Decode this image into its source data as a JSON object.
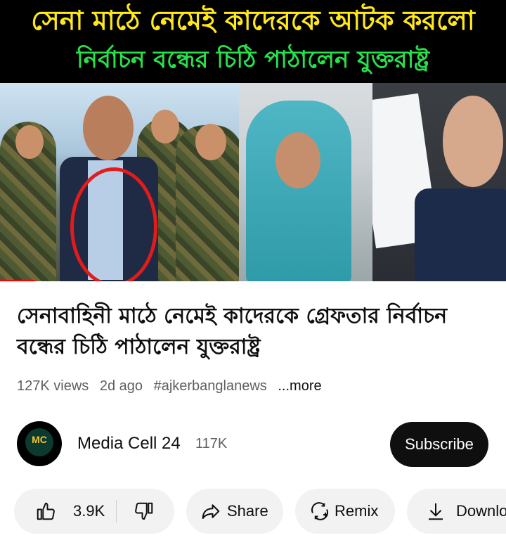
{
  "thumbnail": {
    "headline_line1": "সেনা মাঠে নেমেই কাদেরকে আটক করলো",
    "headline_line2": "নির্বাচন বন্ধের চিঠি পাঠালেন যুক্তরাষ্ট্র",
    "headline_line1_color": "#ffe81a",
    "headline_line2_color": "#27e04a",
    "progress_fraction": 0.07
  },
  "video": {
    "title": "সেনাবাহিনী মাঠে নেমেই কাদেরকে গ্রেফতার নির্বাচন বন্ধের চিঠি পাঠালেন যুক্তরাষ্ট্র",
    "views": "127K views",
    "age": "2d ago",
    "hashtag": "#ajkerbanglanews",
    "more_label": "...more"
  },
  "channel": {
    "avatar_text": "MC",
    "name": "Media Cell 24",
    "subscribers": "117K",
    "subscribe_label": "Subscribe"
  },
  "actions": {
    "like_count": "3.9K",
    "share_label": "Share",
    "remix_label": "Remix",
    "download_label": "Download"
  },
  "colors": {
    "accent": "#ff0000",
    "button_dark": "#0f0f0f",
    "pill_bg": "#f2f2f2",
    "meta_text": "#606060"
  }
}
